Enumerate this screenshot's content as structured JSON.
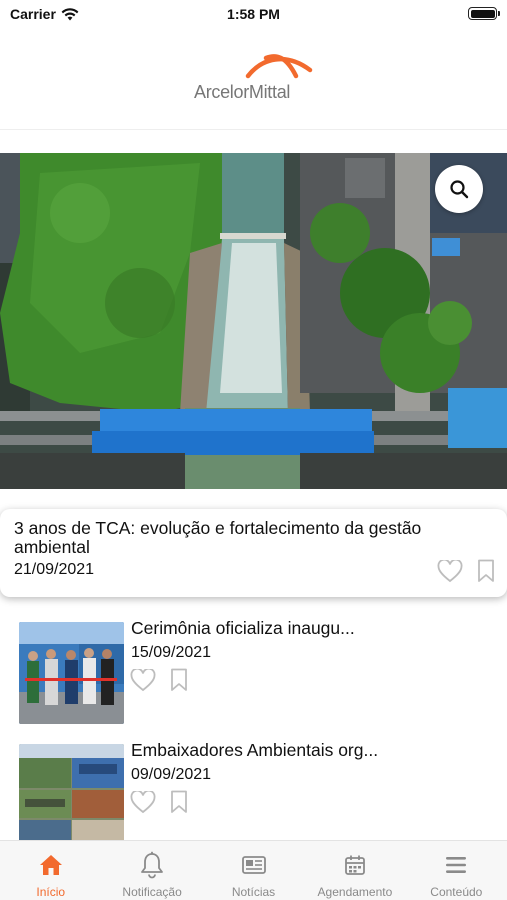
{
  "status_bar": {
    "carrier": "Carrier",
    "time": "1:58 PM"
  },
  "header": {
    "logo_text": "ArcelorMittal",
    "brand_color": "#f26a2e"
  },
  "hero": {
    "search_icon": "search-icon"
  },
  "featured": {
    "title": "3 anos de TCA: evolução e fortalecimento da gestão ambiental",
    "date": "21/09/2021"
  },
  "news": [
    {
      "title": "Cerimônia oficializa inaugu...",
      "date": "15/09/2021"
    },
    {
      "title": "Embaixadores Ambientais org...",
      "date": "09/09/2021"
    }
  ],
  "tabs": [
    {
      "label": "Início",
      "icon": "home-icon",
      "active": true
    },
    {
      "label": "Notificação",
      "icon": "bell-icon",
      "active": false
    },
    {
      "label": "Notícias",
      "icon": "newspaper-icon",
      "active": false
    },
    {
      "label": "Agendamento",
      "icon": "calendar-icon",
      "active": false
    },
    {
      "label": "Conteúdo",
      "icon": "menu-icon",
      "active": false
    }
  ]
}
